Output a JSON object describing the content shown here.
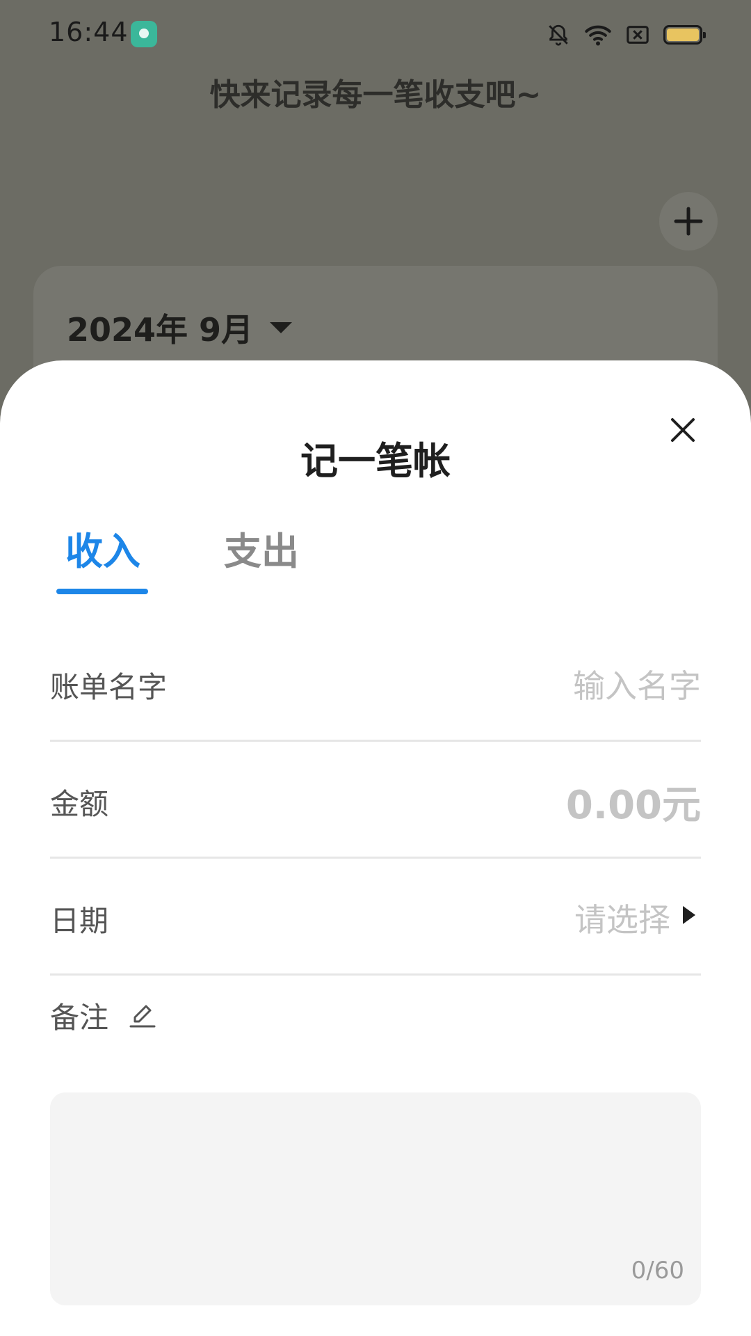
{
  "status_bar": {
    "time": "16:44"
  },
  "background": {
    "slogan": "快来记录每一笔收支吧~",
    "month_selector": "2024年 9月"
  },
  "sheet": {
    "title": "记一笔帐",
    "tabs": [
      {
        "label": "收入",
        "active": true
      },
      {
        "label": "支出",
        "active": false
      }
    ],
    "fields": {
      "name": {
        "label": "账单名字",
        "placeholder": "输入名字"
      },
      "amount": {
        "label": "金额",
        "placeholder": "0.00元"
      },
      "date": {
        "label": "日期",
        "placeholder": "请选择"
      }
    },
    "remark": {
      "label": "备注",
      "counter": "0/60"
    }
  },
  "colors": {
    "accent": "#1d86e8",
    "overlay": "#6c6c64",
    "placeholder": "#c4c4c4"
  }
}
